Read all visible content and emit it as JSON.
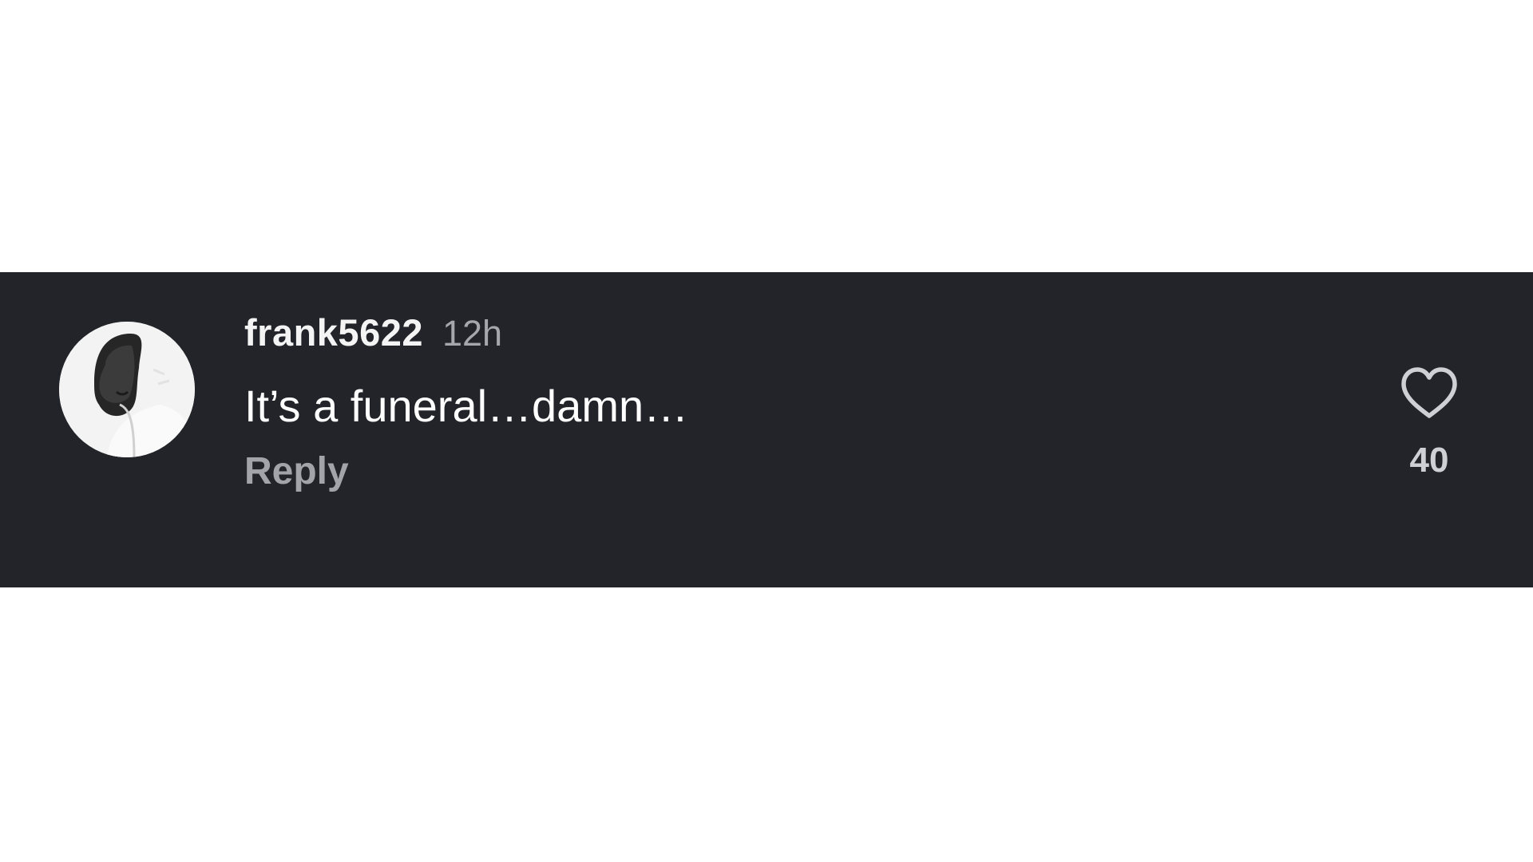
{
  "comment": {
    "username": "frank5622",
    "timestamp": "12h",
    "text": "It’s a funeral…damn…",
    "reply_label": "Reply",
    "like_count": "40",
    "avatar_icon": "profile-photo-icon",
    "like_icon": "heart-outline-icon"
  },
  "colors": {
    "panel_background": "#232429",
    "page_background": "#ffffff",
    "username": "#f4f4f5",
    "secondary_text": "#a5a7ad"
  }
}
